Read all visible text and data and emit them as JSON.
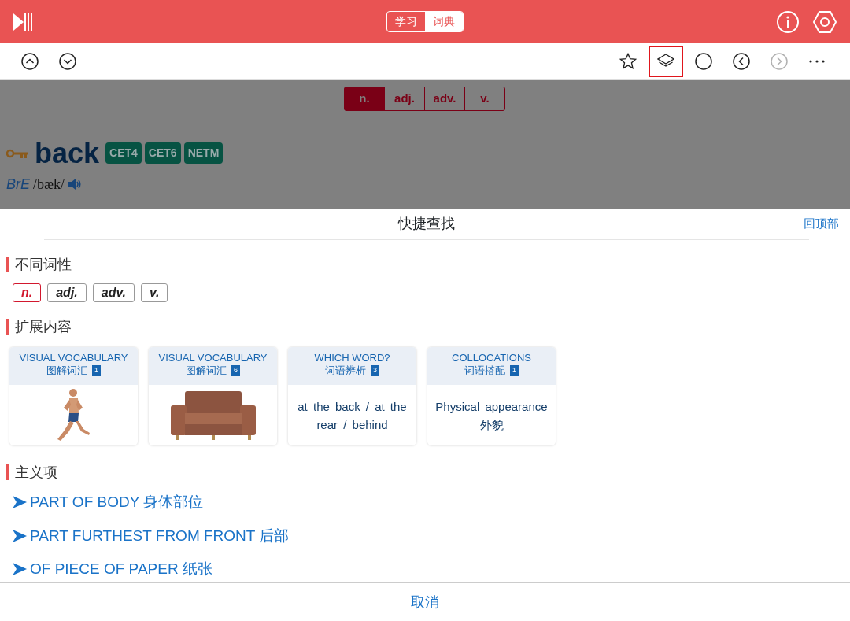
{
  "header": {
    "mode_tabs": [
      {
        "label": "学习",
        "selected": false
      },
      {
        "label": "词典",
        "selected": true
      }
    ]
  },
  "toolbar": {
    "left": [
      {
        "kind": "up"
      },
      {
        "kind": "down"
      }
    ],
    "right": [
      {
        "kind": "star",
        "selected": false,
        "disabled": false
      },
      {
        "kind": "layers",
        "selected": true,
        "disabled": false
      },
      {
        "kind": "circle",
        "selected": false,
        "disabled": false
      },
      {
        "kind": "back",
        "selected": false,
        "disabled": false
      },
      {
        "kind": "forward",
        "selected": false,
        "disabled": true
      },
      {
        "kind": "more",
        "selected": false,
        "disabled": false
      }
    ]
  },
  "entry": {
    "pos_tabs": [
      {
        "label": "n.",
        "selected": true
      },
      {
        "label": "adj.",
        "selected": false
      },
      {
        "label": "adv.",
        "selected": false
      },
      {
        "label": "v.",
        "selected": false
      }
    ],
    "headword": "back",
    "levels": [
      "CET4",
      "CET6",
      "NETM"
    ],
    "pronunciation": {
      "label": "BrE",
      "ipa": "/bæk/"
    }
  },
  "sheet": {
    "title": "快捷查找",
    "top_link": "回顶部",
    "pos_section": {
      "heading": "不同词性",
      "items": [
        {
          "label": "n.",
          "selected": true
        },
        {
          "label": "adj.",
          "selected": false
        },
        {
          "label": "adv.",
          "selected": false
        },
        {
          "label": "v.",
          "selected": false
        }
      ]
    },
    "extended_section": {
      "heading": "扩展内容",
      "cards": [
        {
          "kind": "runner",
          "title": "VISUAL VOCABULARY",
          "subtitle": "图解词汇",
          "count": "1"
        },
        {
          "kind": "sofa",
          "title": "VISUAL VOCABULARY",
          "subtitle": "图解词汇",
          "count": "6"
        },
        {
          "kind": "text",
          "title": "WHICH  WORD?",
          "subtitle": "词语辨析",
          "count": "3",
          "text": "at the back / at the rear / behind"
        },
        {
          "kind": "text",
          "title": "COLLOCATIONS",
          "subtitle": "词语搭配",
          "count": "1",
          "text": "Physical appearance 外貌"
        }
      ]
    },
    "senses_section": {
      "heading": "主义项",
      "items": [
        "PART OF BODY 身体部位",
        "PART FURTHEST FROM FRONT 后部",
        "OF PIECE OF PAPER 纸张"
      ]
    },
    "cancel": "取消"
  }
}
